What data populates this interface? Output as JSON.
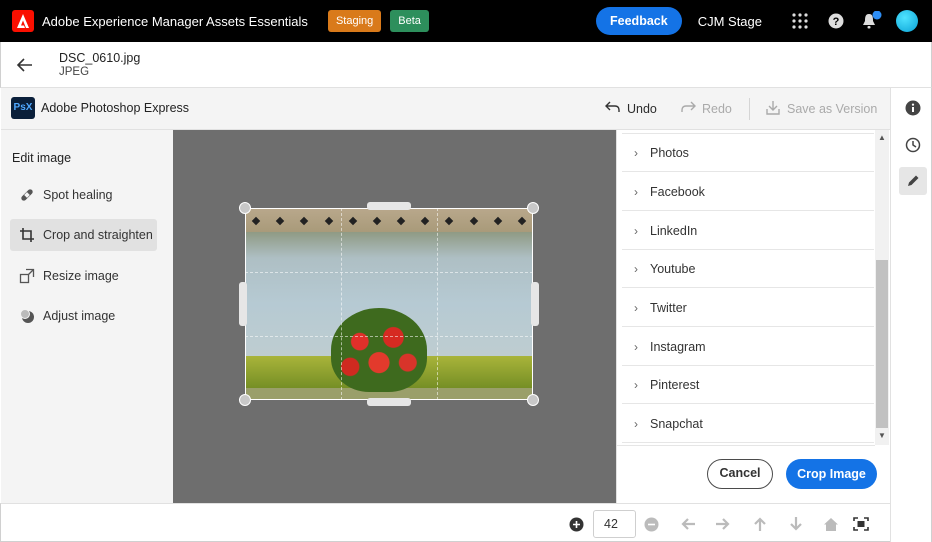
{
  "topbar": {
    "app_title": "Adobe Experience Manager Assets Essentials",
    "badge_staging": "Staging",
    "badge_beta": "Beta",
    "feedback_label": "Feedback",
    "org_name": "CJM Stage",
    "icons": [
      "adobe-logo-icon",
      "app-grid-icon",
      "help-icon",
      "bell-icon",
      "avatar"
    ],
    "colors": {
      "staging": "#d97a1a",
      "beta": "#2d8f5c",
      "accent": "#1473e6"
    }
  },
  "file": {
    "name": "DSC_0610.jpg",
    "type": "JPEG"
  },
  "editor": {
    "title": "Adobe Photoshop Express",
    "logo_text": "PsX",
    "undo_label": "Undo",
    "redo_label": "Redo",
    "save_version_label": "Save as Version"
  },
  "left_panel": {
    "title": "Edit image",
    "items": [
      {
        "label": "Spot healing",
        "icon": "bandage-icon"
      },
      {
        "label": "Crop and straighten",
        "icon": "crop-icon",
        "active": true
      },
      {
        "label": "Resize image",
        "icon": "resize-icon"
      },
      {
        "label": "Adjust image",
        "icon": "adjust-icon"
      }
    ]
  },
  "right_panel": {
    "presets": [
      {
        "label": "Photos"
      },
      {
        "label": "Facebook"
      },
      {
        "label": "LinkedIn"
      },
      {
        "label": "Youtube"
      },
      {
        "label": "Twitter"
      },
      {
        "label": "Instagram"
      },
      {
        "label": "Pinterest"
      },
      {
        "label": "Snapchat"
      }
    ],
    "cancel_label": "Cancel",
    "crop_label": "Crop Image"
  },
  "bottombar": {
    "zoom_value": "42",
    "icons": [
      "zoom-in-icon",
      "zoom-out-icon",
      "arrow-left-icon",
      "arrow-right-icon",
      "arrow-up-icon",
      "arrow-down-icon",
      "home-icon",
      "fit-screen-icon"
    ]
  },
  "rail": {
    "icons": [
      "info-icon",
      "history-icon",
      "edit-icon"
    ]
  }
}
